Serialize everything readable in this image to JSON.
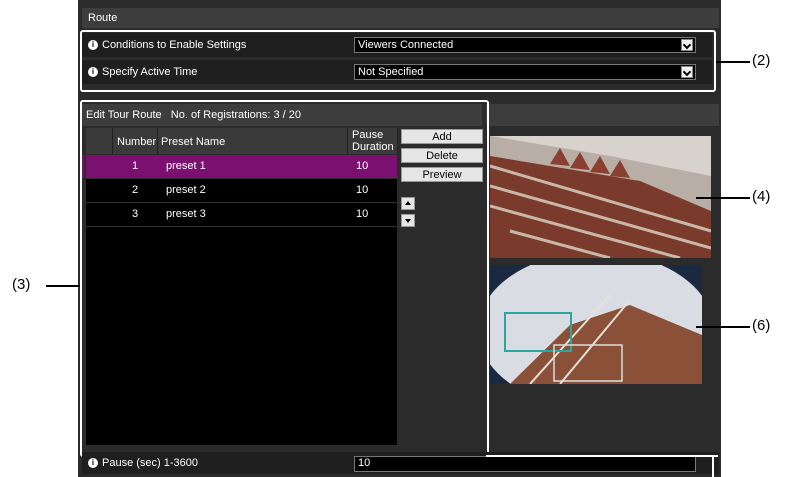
{
  "route": {
    "header": "Route",
    "settings": [
      {
        "label": "Conditions to Enable Settings",
        "value": "Viewers Connected"
      },
      {
        "label": "Specify Active Time",
        "value": "Not Specified"
      }
    ]
  },
  "tour": {
    "header": "Edit Tour Route   No. of Registrations: 3 / 20",
    "columns": {
      "number": "Number",
      "preset": "Preset Name",
      "pause": "Pause Duration"
    },
    "rows": [
      {
        "number": "1",
        "preset": "preset 1",
        "pause": "10",
        "selected": true
      },
      {
        "number": "2",
        "preset": "preset 2",
        "pause": "10",
        "selected": false
      },
      {
        "number": "3",
        "preset": "preset 3",
        "pause": "10",
        "selected": false
      }
    ],
    "buttons": {
      "add": "Add",
      "delete": "Delete",
      "preview": "Preview"
    }
  },
  "pause": {
    "label": "Pause (sec) 1-3600",
    "value": "10"
  },
  "callouts": {
    "c2": "(2)",
    "c3": "(3)",
    "c4": "(4)",
    "c6": "(6)"
  },
  "colors": {
    "selected_row": "#7b1070",
    "panel": "#2b2b2b"
  }
}
